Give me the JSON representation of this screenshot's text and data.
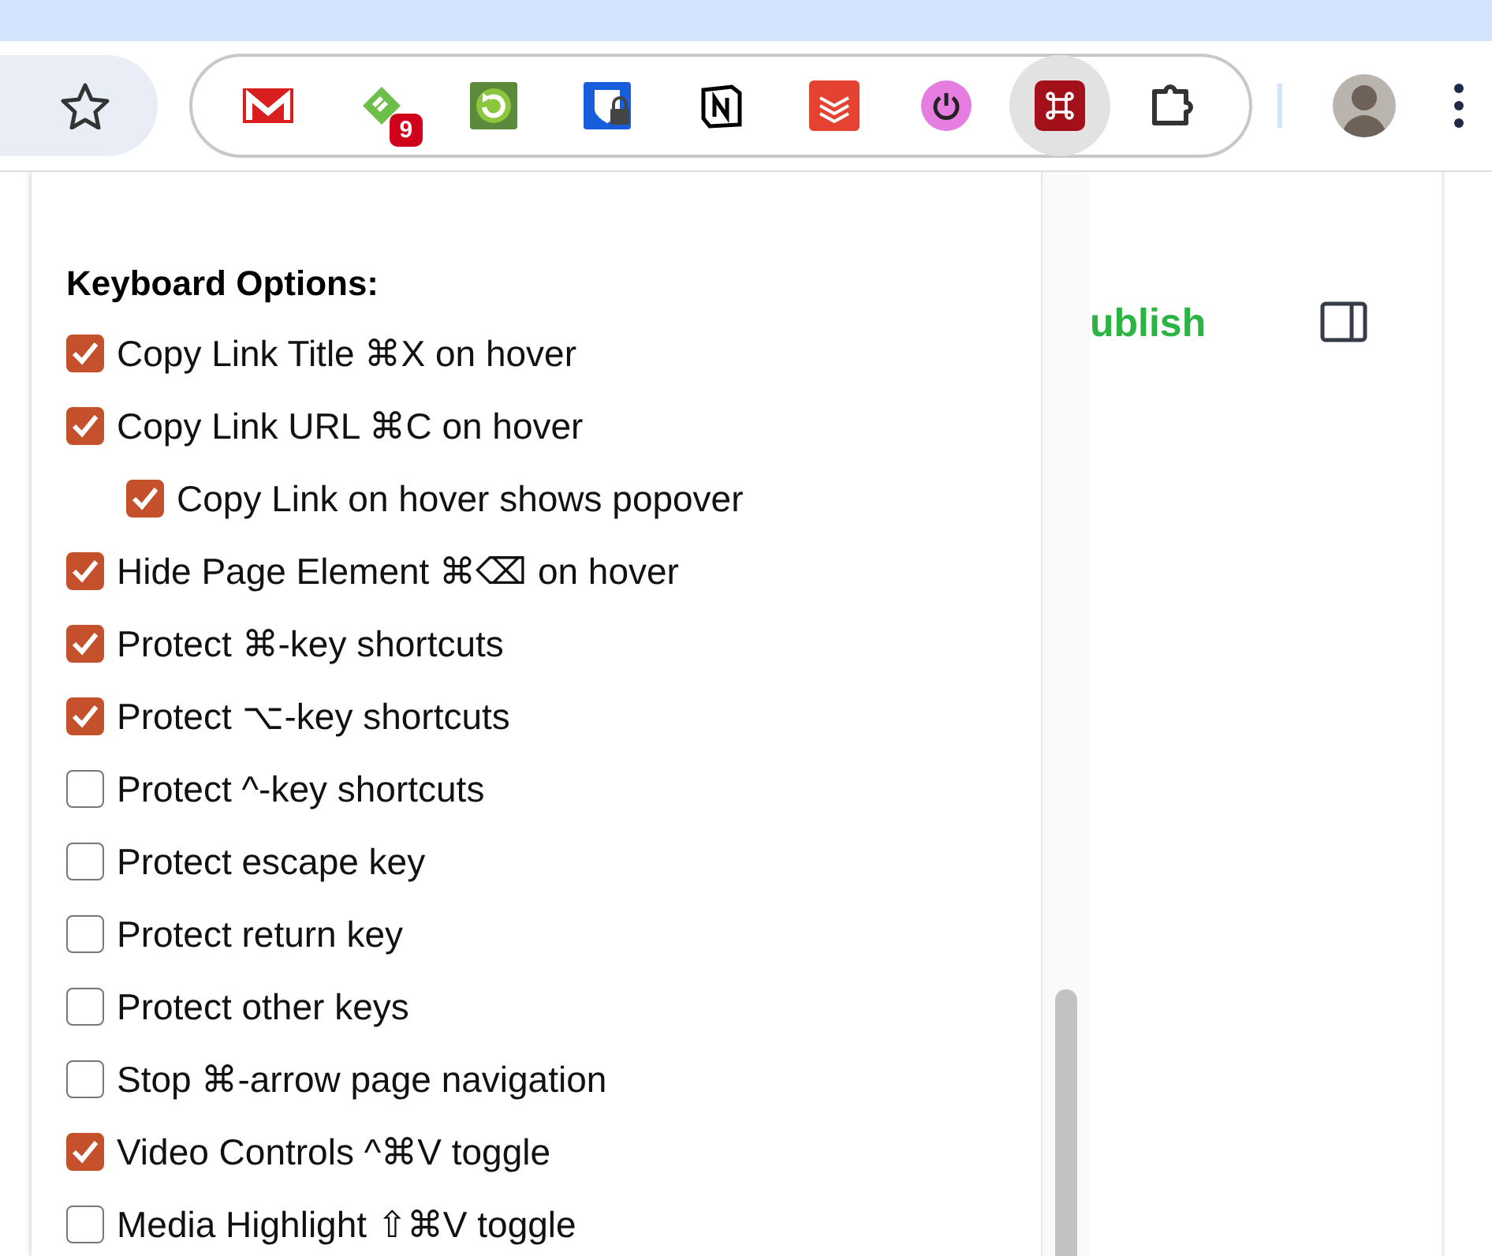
{
  "toolbar": {
    "extensions": [
      {
        "kind": "mail",
        "selected": false
      },
      {
        "kind": "tag",
        "badge": "9",
        "selected": false
      },
      {
        "kind": "refresh",
        "selected": false
      },
      {
        "kind": "lock",
        "selected": false
      },
      {
        "kind": "notebook",
        "selected": false
      },
      {
        "kind": "layers",
        "selected": false
      },
      {
        "kind": "power",
        "selected": false
      },
      {
        "kind": "command",
        "selected": true
      },
      {
        "kind": "puzzle",
        "selected": false
      }
    ]
  },
  "popup": {
    "heading": "Keyboard Options:",
    "options": [
      {
        "label": "Copy Link Title ⌘X on hover",
        "checked": true
      },
      {
        "label": "Copy Link URL ⌘C on hover",
        "checked": true,
        "children": [
          {
            "label": "Copy Link on hover shows popover",
            "checked": true
          }
        ]
      },
      {
        "label": "Hide Page Element ⌘⌫ on hover",
        "checked": true
      },
      {
        "label": "Protect ⌘-key shortcuts",
        "checked": true
      },
      {
        "label": "Protect ⌥-key shortcuts",
        "checked": true
      },
      {
        "label": "Protect ^-key shortcuts",
        "checked": false
      },
      {
        "label": "Protect escape key",
        "checked": false
      },
      {
        "label": "Protect return key",
        "checked": false
      },
      {
        "label": "Protect other keys",
        "checked": false
      },
      {
        "label": "Stop ⌘-arrow page navigation",
        "checked": false
      },
      {
        "label": "Video Controls ^⌘V toggle",
        "checked": true
      },
      {
        "label": "Media Highlight ⇧⌘V toggle",
        "checked": false
      }
    ]
  },
  "page": {
    "publish_text": "ublish"
  }
}
